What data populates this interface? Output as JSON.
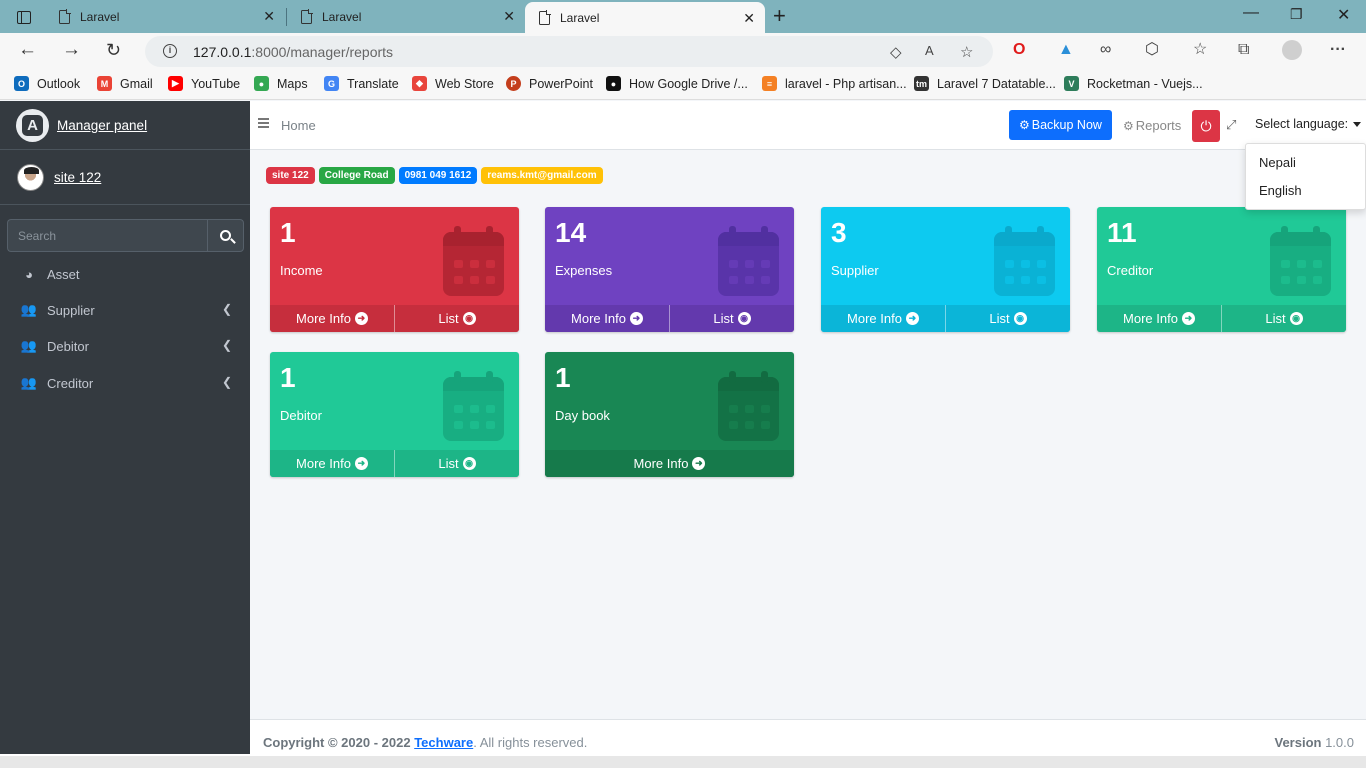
{
  "browser": {
    "tabs": [
      {
        "title": "Laravel"
      },
      {
        "title": "Laravel"
      },
      {
        "title": "Laravel"
      }
    ],
    "url_host": "127.0.0.1",
    "url_rest": ":8000/manager/reports",
    "bookmarks": [
      {
        "label": "Outlook",
        "color": "#0f6cbd",
        "glyph": "O"
      },
      {
        "label": "Gmail",
        "color": "#ea4335",
        "glyph": "M"
      },
      {
        "label": "YouTube",
        "color": "#ff0000",
        "glyph": "▶"
      },
      {
        "label": "Maps",
        "color": "#34a853",
        "glyph": "●"
      },
      {
        "label": "Translate",
        "color": "#4285f4",
        "glyph": "G"
      },
      {
        "label": "Web Store",
        "color": "#e8453c",
        "glyph": "◆"
      },
      {
        "label": "PowerPoint",
        "color": "#c43e1c",
        "glyph": "P"
      },
      {
        "label": "How Google Drive /...",
        "color": "#111111",
        "glyph": "●"
      },
      {
        "label": "laravel - Php artisan...",
        "color": "#f48024",
        "glyph": "≡"
      },
      {
        "label": "Laravel 7 Datatable...",
        "color": "#333333",
        "glyph": "tm"
      },
      {
        "label": "Rocketman - Vuejs...",
        "color": "#2e7d5b",
        "glyph": "V"
      }
    ]
  },
  "sidebar": {
    "brand": "Manager panel",
    "brand_logo": "A",
    "user": "site 122",
    "search_placeholder": "Search",
    "items": [
      {
        "label": "Asset",
        "icon": "palette-icon"
      },
      {
        "label": "Supplier",
        "icon": "users-icon"
      },
      {
        "label": "Debitor",
        "icon": "users-icon"
      },
      {
        "label": "Creditor",
        "icon": "users-icon"
      }
    ]
  },
  "header": {
    "home": "Home",
    "backup": "Backup Now",
    "reports": "Reports",
    "language": "Select language:",
    "languages": [
      "Nepali",
      "English"
    ]
  },
  "badges": [
    {
      "text": "site 122",
      "color": "#dc3545"
    },
    {
      "text": "College Road",
      "color": "#28a745"
    },
    {
      "text": "0981 049 1612",
      "color": "#007bff"
    },
    {
      "text": "reams.kmt@gmail.com",
      "color": "#ffc107"
    }
  ],
  "boxes": [
    {
      "count": "1",
      "label": "Income",
      "more": "More Info",
      "list": "List",
      "color": "#dc3545"
    },
    {
      "count": "14",
      "label": "Expenses",
      "more": "More Info",
      "list": "List",
      "color": "#6f42c1"
    },
    {
      "count": "3",
      "label": "Supplier",
      "more": "More Info",
      "list": "List",
      "color": "#0dcaf0"
    },
    {
      "count": "11",
      "label": "Creditor",
      "more": "More Info",
      "list": "List",
      "color": "#20c997"
    },
    {
      "count": "1",
      "label": "Debitor",
      "more": "More Info",
      "list": "List",
      "color": "#20c997"
    },
    {
      "count": "1",
      "label": "Day book",
      "more": "More Info",
      "color": "#198754"
    }
  ],
  "footer": {
    "copyright": "Copyright © 2020 - 2022",
    "company": "Techware",
    "rights": ". All rights reserved.",
    "version_label": "Version",
    "version": "1.0.0"
  }
}
